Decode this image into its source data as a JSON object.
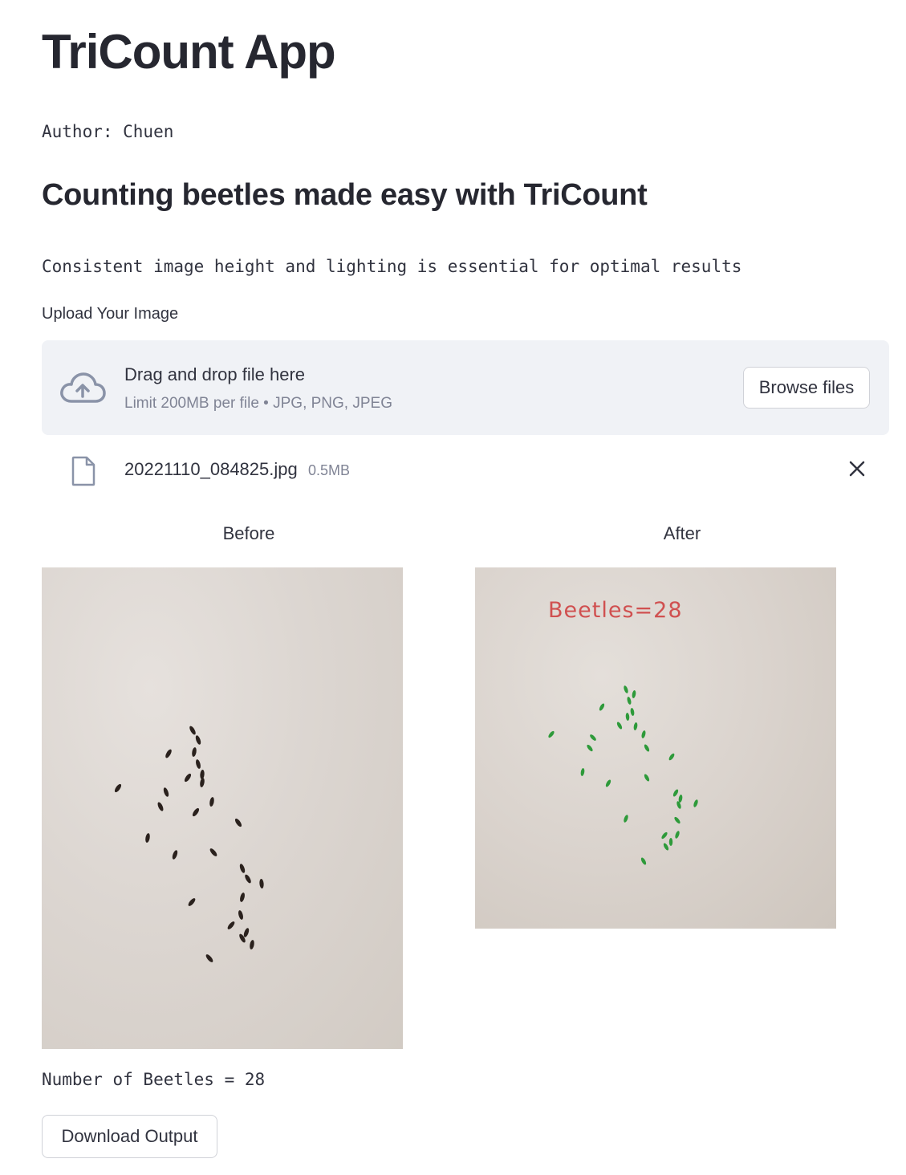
{
  "app": {
    "title": "TriCount App"
  },
  "author": "Author: Chuen",
  "subtitle": "Counting beetles made easy with TriCount",
  "note": "Consistent image height and lighting is essential for optimal results",
  "uploader": {
    "label": "Upload Your Image",
    "drop_title": "Drag and drop file here",
    "limit_text": "Limit 200MB per file • JPG, PNG, JPEG",
    "browse_label": "Browse files",
    "icon": "cloud-upload-icon"
  },
  "uploaded_file": {
    "name": "20221110_084825.jpg",
    "size": "0.5MB",
    "file_icon": "file-icon",
    "remove_icon": "close-icon"
  },
  "columns": {
    "before_label": "Before",
    "after_label": "After"
  },
  "after_overlay_text": "Beetles=28",
  "result_text": "Number of Beetles = 28",
  "download_label": "Download Output",
  "colors": {
    "accent_beetle_dark": "#2a211d",
    "accent_beetle_detected": "#2e9a3a",
    "overlay_text": "#d05050",
    "dropzone_bg": "#f0f2f6"
  }
}
